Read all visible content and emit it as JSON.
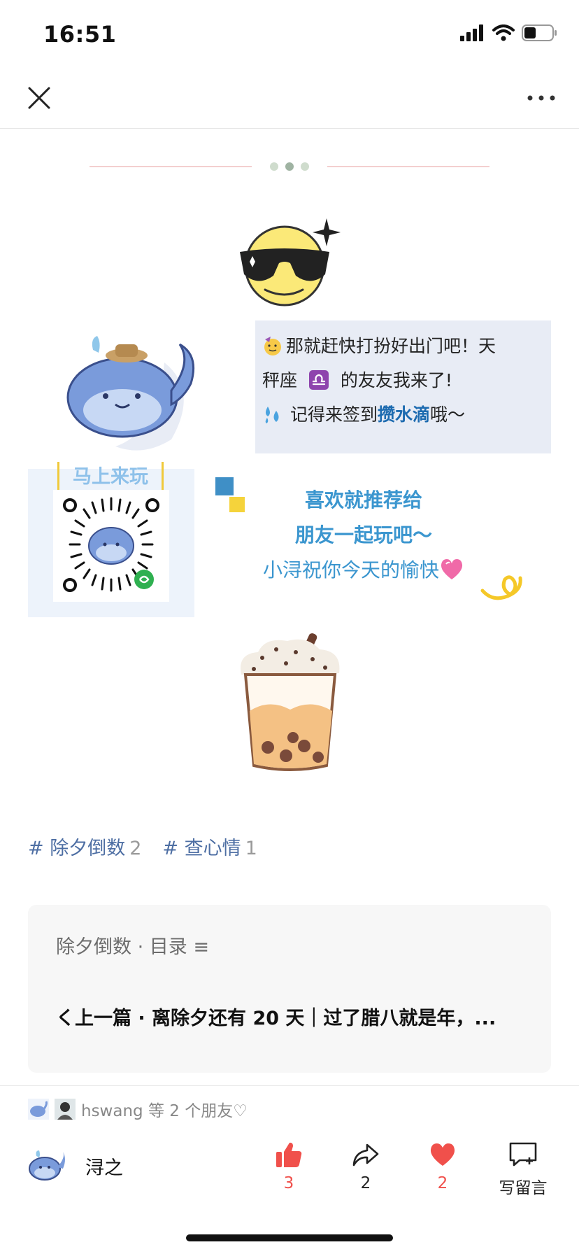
{
  "status_bar": {
    "time": "16:51"
  },
  "nav": {
    "close_icon": "close-icon",
    "more_icon": "more-dots-icon"
  },
  "message": {
    "line1": "那就赶快打扮好出门吧！天",
    "line2_a": "秤座",
    "line2_b": "的友友我来了!",
    "line3_a": "记得来签到",
    "line3_highlight": "攒水滴",
    "line3_b": "哦～"
  },
  "qr": {
    "label": "马上来玩"
  },
  "promo": {
    "line1": "喜欢就推荐给",
    "line2": "朋友一起玩吧～",
    "line3": "小浔祝你今天的愉快"
  },
  "tags": [
    {
      "label": "# 除夕倒数",
      "count": "2"
    },
    {
      "label": "# 查心情",
      "count": "1"
    }
  ],
  "toc": {
    "title": "除夕倒数 · 目录 ≡",
    "prev": "く上一篇 · 离除夕还有 20 天｜过了腊八就是年，..."
  },
  "friends": {
    "text": "hswang 等 2 个朋友♡"
  },
  "author": {
    "name": "浔之"
  },
  "actions": {
    "like_count": "3",
    "share_count": "2",
    "love_count": "2",
    "comment_label": "写留言"
  },
  "colors": {
    "accent_blue": "#3b96cf",
    "tag_blue": "#4d6ea3",
    "like_red": "#f0504b",
    "highlight_box": "#e8ecf5"
  }
}
